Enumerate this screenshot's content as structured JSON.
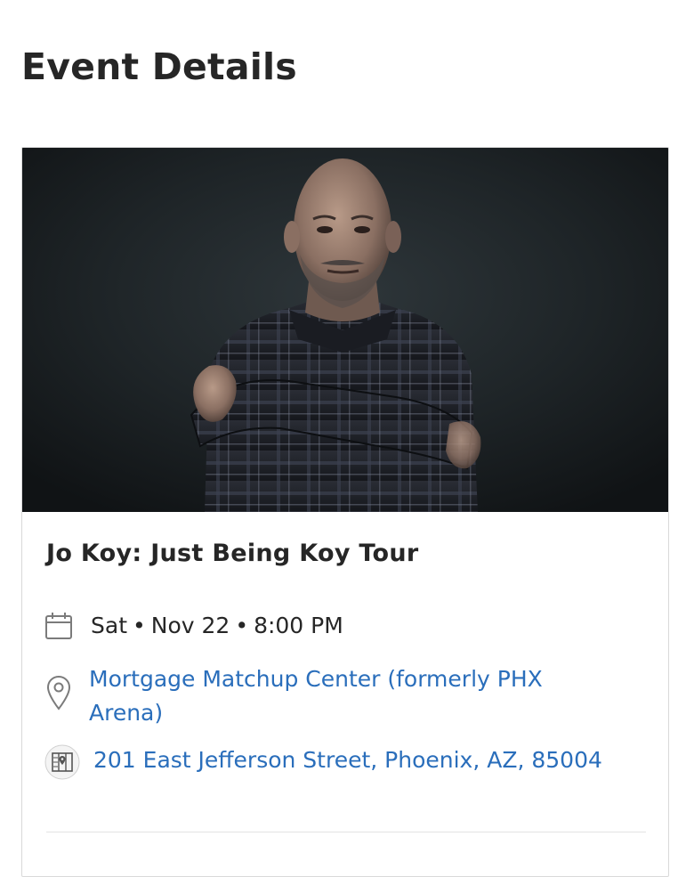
{
  "page": {
    "title": "Event Details"
  },
  "event": {
    "name": "Jo Koy: Just Being Koy Tour",
    "image_alt": "Jo Koy promotional photo",
    "day": "Sat",
    "date": "Nov 22",
    "time": "8:00 PM",
    "separator": "•",
    "venue": "Mortgage Matchup Center (formerly PHX Arena)",
    "address": "201 East Jefferson Street, Phoenix, AZ, 85004"
  },
  "icons": {
    "calendar": "calendar-icon",
    "location": "location-pin-icon",
    "map": "map-icon"
  },
  "colors": {
    "link": "#2a6ebb",
    "text": "#262626"
  }
}
